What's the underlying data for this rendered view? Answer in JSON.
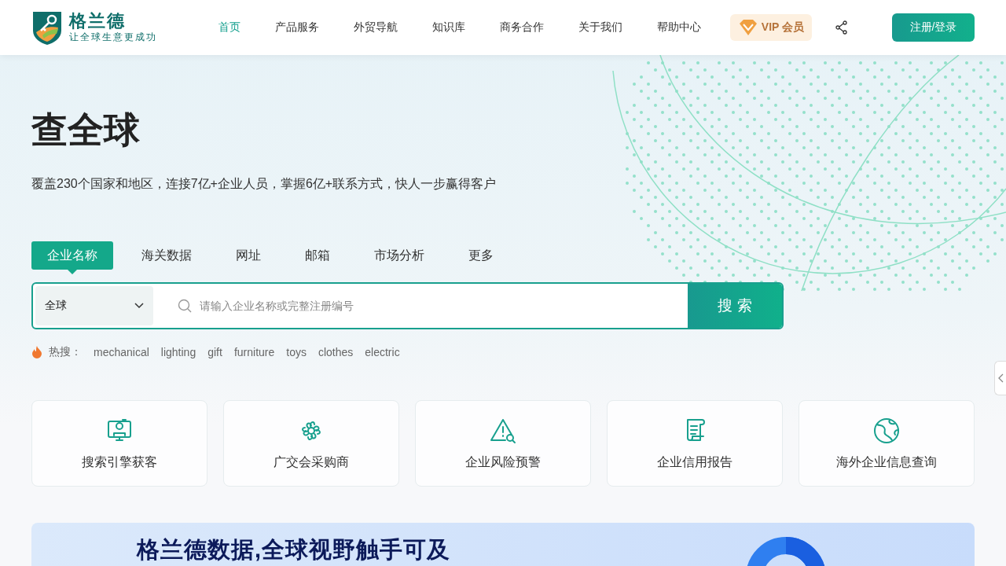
{
  "header": {
    "logo": {
      "name": "格兰德",
      "slogan": "让全球生意更成功"
    },
    "nav": [
      {
        "label": "首页",
        "selected": true
      },
      {
        "label": "产品服务",
        "selected": false
      },
      {
        "label": "外贸导航",
        "selected": false
      },
      {
        "label": "知识库",
        "selected": false
      },
      {
        "label": "商务合作",
        "selected": false
      },
      {
        "label": "关于我们",
        "selected": false
      },
      {
        "label": "帮助中心",
        "selected": false
      }
    ],
    "vip": "VIP 会员",
    "login": "注册/登录"
  },
  "hero": {
    "title": "查全球",
    "subtitle": "覆盖230个国家和地区，连接7亿+企业人员，掌握6亿+联系方式，快人一步赢得客户"
  },
  "search": {
    "tabs": [
      {
        "label": "企业名称",
        "selected": true
      },
      {
        "label": "海关数据",
        "selected": false
      },
      {
        "label": "网址",
        "selected": false
      },
      {
        "label": "邮箱",
        "selected": false
      },
      {
        "label": "市场分析",
        "selected": false
      },
      {
        "label": "更多",
        "selected": false
      }
    ],
    "region": "全球",
    "placeholder": "请输入企业名称或完整注册编号",
    "button": "搜 索",
    "hot_label": "热搜：",
    "hot": [
      "mechanical",
      "lighting",
      "gift",
      "furniture",
      "toys",
      "clothes",
      "electric"
    ]
  },
  "features": [
    {
      "kind": "monitor",
      "label": "搜索引擎获客"
    },
    {
      "kind": "flower",
      "label": "广交会采购商"
    },
    {
      "kind": "warning",
      "label": "企业风险预警"
    },
    {
      "kind": "scroll",
      "label": "企业信用报告"
    },
    {
      "kind": "globe",
      "label": "海外企业信息查询"
    }
  ],
  "banner": {
    "headline": "格兰德数据,全球视野触手可及"
  }
}
